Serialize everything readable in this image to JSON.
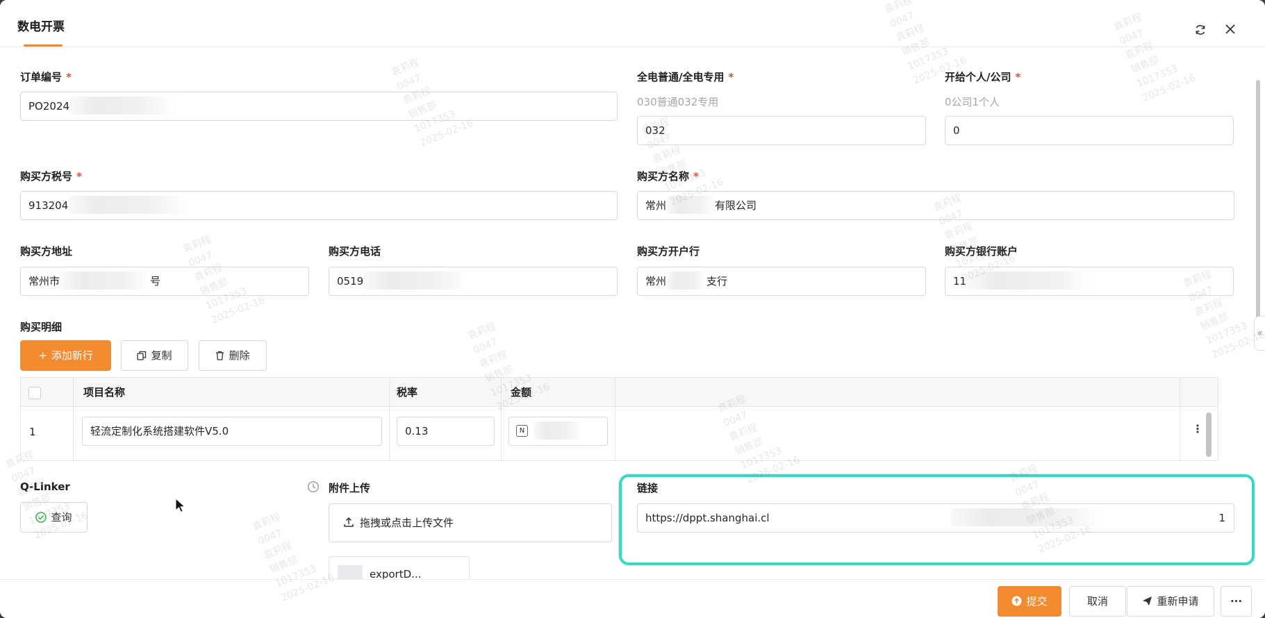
{
  "header": {
    "title": "数电开票"
  },
  "form": {
    "order_no": {
      "label": "订单编号",
      "value": "PO2024"
    },
    "invoice_type": {
      "label": "全电普通/全电专用",
      "hint": "030普通032专用",
      "value": "032"
    },
    "issue_to": {
      "label": "开给个人/公司",
      "hint": "0公司1个人",
      "value": "0"
    },
    "buyer_tax_no": {
      "label": "购买方税号",
      "value": "913204"
    },
    "buyer_name": {
      "label": "购买方名称",
      "value_prefix": "常州",
      "value_suffix": "有限公司"
    },
    "buyer_address": {
      "label": "购买方地址",
      "value_prefix": "常州市",
      "value_suffix": "号"
    },
    "buyer_phone": {
      "label": "购买方电话",
      "value": "0519"
    },
    "buyer_bank": {
      "label": "购买方开户行",
      "value_prefix": "常州",
      "value_suffix": "支行"
    },
    "buyer_account": {
      "label": "购买方银行账户",
      "value": "11"
    }
  },
  "details": {
    "label": "购买明细",
    "add_button": "添加新行",
    "copy_button": "复制",
    "delete_button": "删除",
    "columns": [
      "项目名称",
      "税率",
      "金额"
    ],
    "rows": [
      {
        "index": "1",
        "item_name": "轻流定制化系统搭建软件V5.0",
        "tax_rate": "0.13",
        "amount_icon": "N"
      }
    ]
  },
  "qlinker": {
    "label": "Q-Linker",
    "query_button": "查询"
  },
  "attachment": {
    "label": "附件上传",
    "upload_text": "拖拽或点击上传文件",
    "file_name": "exportD..."
  },
  "link": {
    "label": "链接",
    "value": "https://dppt.shanghai.cl",
    "tail": "1"
  },
  "footer": {
    "submit": "提交",
    "cancel": "取消",
    "reapply": "重新申请",
    "more": "···"
  },
  "icons": {
    "refresh": "refresh-icon",
    "close": "close-icon",
    "collapse": "double-chevron-left-icon",
    "history": "clock-icon"
  },
  "colors": {
    "primary": "#f28a2f",
    "required": "#e34d3c",
    "highlight": "#3dd6c1"
  },
  "watermark": {
    "lines": "袁莉程\n0047\n袁莉程\n销售部\n1017353\n2025-02-16"
  }
}
